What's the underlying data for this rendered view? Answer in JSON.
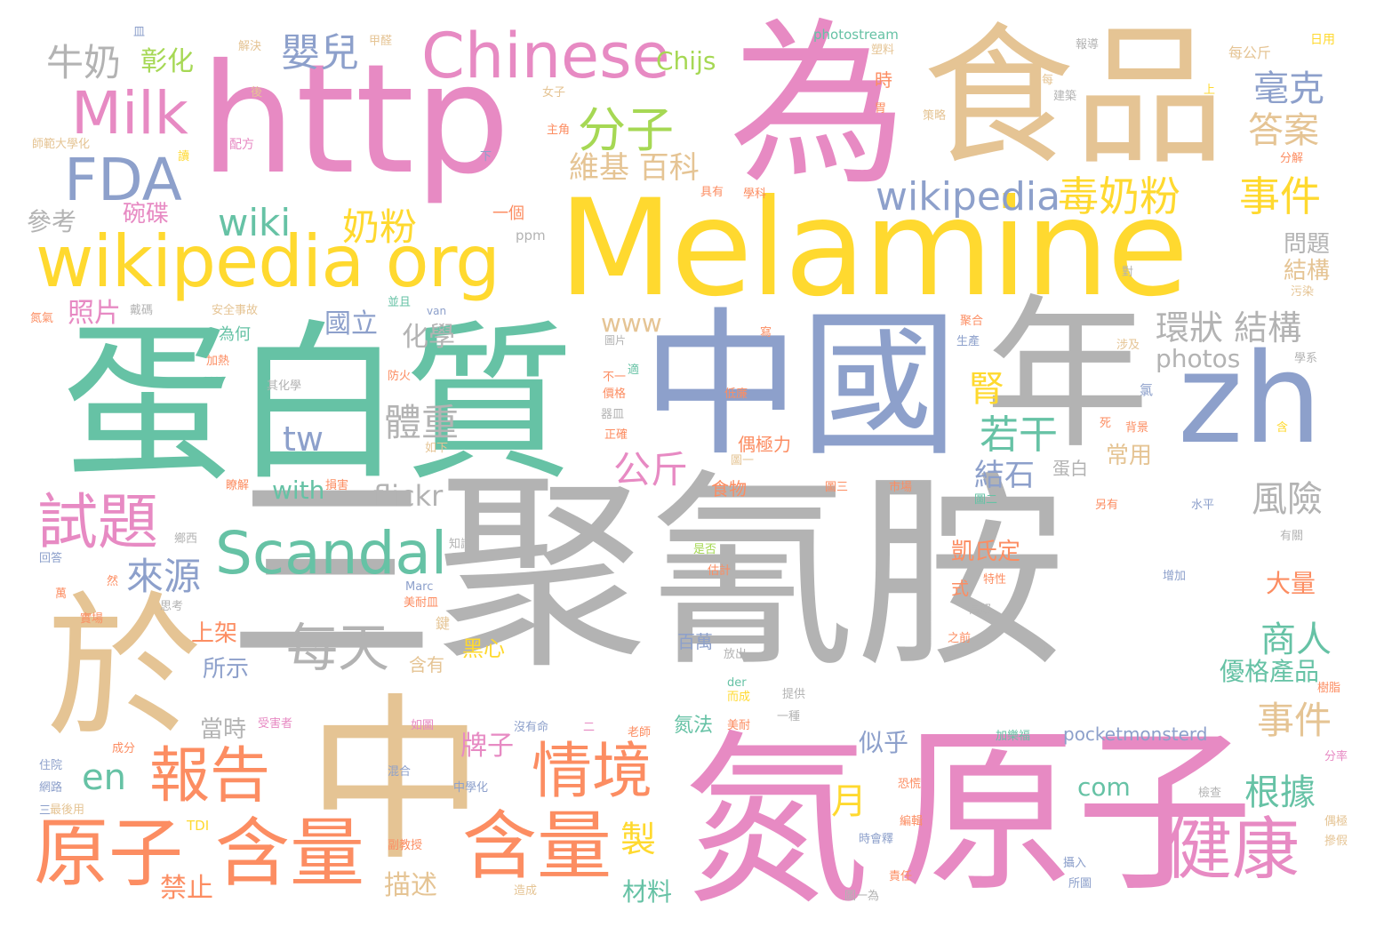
{
  "palette": {
    "pink": "#e78ac3",
    "yellow": "#ffd92f",
    "tan": "#e5c494",
    "gray": "#b3b3b3",
    "teal": "#66c2a5",
    "blue": "#8da0cb",
    "orange": "#fc8d62",
    "green": "#a6d854"
  },
  "words": [
    {
      "text": "三聚氰胺",
      "color": "gray"
    },
    {
      "text": "Melamine",
      "color": "yellow"
    },
    {
      "text": "中國",
      "color": "blue"
    },
    {
      "text": "蛋白質",
      "color": "teal"
    },
    {
      "text": "食品",
      "color": "tan"
    },
    {
      "text": "http",
      "color": "pink"
    },
    {
      "text": "為",
      "color": "pink"
    },
    {
      "text": "年",
      "color": "gray"
    },
    {
      "text": "氮",
      "color": "pink"
    },
    {
      "text": "原子",
      "color": "pink"
    },
    {
      "text": "中",
      "color": "tan"
    },
    {
      "text": "於",
      "color": "tan"
    },
    {
      "text": "zh",
      "color": "blue"
    },
    {
      "text": "wikipedia org",
      "color": "yellow"
    },
    {
      "text": "Chinese",
      "color": "pink"
    },
    {
      "text": "Milk",
      "color": "pink"
    },
    {
      "text": "FDA",
      "color": "blue"
    },
    {
      "text": "Scandal",
      "color": "teal"
    },
    {
      "text": "原子",
      "color": "orange"
    },
    {
      "text": "含量",
      "color": "orange"
    },
    {
      "text": "含量",
      "color": "orange"
    },
    {
      "text": "情境",
      "color": "orange"
    },
    {
      "text": "報告",
      "color": "orange"
    },
    {
      "text": "試題",
      "color": "pink"
    },
    {
      "text": "健康",
      "color": "pink"
    },
    {
      "text": "wikipedia",
      "color": "blue"
    },
    {
      "text": "毒奶粉",
      "color": "yellow"
    },
    {
      "text": "事件",
      "color": "yellow"
    },
    {
      "text": "分子",
      "color": "green"
    },
    {
      "text": "每天",
      "color": "gray"
    },
    {
      "text": "嬰兒",
      "color": "blue"
    },
    {
      "text": "牛奶",
      "color": "gray"
    },
    {
      "text": "彰化",
      "color": "green"
    },
    {
      "text": "wiki",
      "color": "teal"
    },
    {
      "text": "奶粉",
      "color": "yellow"
    },
    {
      "text": "維基 百科",
      "color": "tan"
    },
    {
      "text": "毫克",
      "color": "blue"
    },
    {
      "text": "答案",
      "color": "tan"
    },
    {
      "text": "Chijs",
      "color": "green"
    },
    {
      "text": "tw",
      "color": "blue"
    },
    {
      "text": "來源",
      "color": "blue"
    },
    {
      "text": "en",
      "color": "teal"
    },
    {
      "text": "照片",
      "color": "pink"
    },
    {
      "text": "碗碟",
      "color": "pink"
    },
    {
      "text": "參考",
      "color": "gray"
    },
    {
      "text": "國立",
      "color": "blue"
    },
    {
      "text": "化學",
      "color": "gray"
    },
    {
      "text": "環狀 結構",
      "color": "gray"
    },
    {
      "text": "體重",
      "color": "gray"
    },
    {
      "text": "腎",
      "color": "yellow"
    },
    {
      "text": "若干",
      "color": "teal"
    },
    {
      "text": "結石",
      "color": "blue"
    },
    {
      "text": "photos",
      "color": "gray"
    },
    {
      "text": "風險",
      "color": "gray"
    },
    {
      "text": "公斤",
      "color": "pink"
    },
    {
      "text": "with",
      "color": "teal"
    },
    {
      "text": "flickr",
      "color": "gray"
    },
    {
      "text": "商人",
      "color": "teal"
    },
    {
      "text": "優格產品",
      "color": "teal"
    },
    {
      "text": "事件",
      "color": "tan"
    },
    {
      "text": "根據",
      "color": "teal"
    },
    {
      "text": "月",
      "color": "yellow"
    },
    {
      "text": "製",
      "color": "yellow"
    },
    {
      "text": "com",
      "color": "teal"
    },
    {
      "text": "似乎",
      "color": "blue"
    },
    {
      "text": "牌子",
      "color": "pink"
    },
    {
      "text": "凱氏定",
      "color": "orange"
    },
    {
      "text": "大量",
      "color": "orange"
    },
    {
      "text": "上架",
      "color": "orange"
    },
    {
      "text": "所示",
      "color": "blue"
    },
    {
      "text": "當時",
      "color": "gray"
    },
    {
      "text": "禁止",
      "color": "orange"
    },
    {
      "text": "描述",
      "color": "tan"
    },
    {
      "text": "材料",
      "color": "teal"
    },
    {
      "text": "www",
      "color": "tan"
    },
    {
      "text": "問題",
      "color": "gray"
    },
    {
      "text": "結構",
      "color": "tan"
    },
    {
      "text": "常用",
      "color": "tan"
    },
    {
      "text": "pocketmonsterd",
      "color": "blue"
    },
    {
      "text": "為何",
      "color": "teal"
    },
    {
      "text": "一個",
      "color": "orange"
    },
    {
      "text": "黑心",
      "color": "yellow"
    },
    {
      "text": "含有",
      "color": "tan"
    },
    {
      "text": "百萬",
      "color": "blue"
    },
    {
      "text": "氮法",
      "color": "teal"
    },
    {
      "text": "食物",
      "color": "orange"
    },
    {
      "text": "偶極力",
      "color": "orange"
    },
    {
      "text": "photostream",
      "color": "teal"
    },
    {
      "text": "ppm",
      "color": "gray"
    },
    {
      "text": "van",
      "color": "blue"
    },
    {
      "text": "TDI",
      "color": "yellow"
    },
    {
      "text": "der",
      "color": "teal"
    },
    {
      "text": "Marc",
      "color": "blue"
    },
    {
      "text": "in",
      "color": "gray"
    },
    {
      "text": "解決",
      "color": "tan"
    },
    {
      "text": "甲醛",
      "color": "tan"
    },
    {
      "text": "報導",
      "color": "gray"
    },
    {
      "text": "每公斤",
      "color": "tan"
    },
    {
      "text": "日用",
      "color": "yellow"
    },
    {
      "text": "塑料",
      "color": "tan"
    },
    {
      "text": "時",
      "color": "orange"
    },
    {
      "text": "建築",
      "color": "gray"
    },
    {
      "text": "策略",
      "color": "tan"
    },
    {
      "text": "主角",
      "color": "orange"
    },
    {
      "text": "女子",
      "color": "tan"
    },
    {
      "text": "師範大學化",
      "color": "tan"
    },
    {
      "text": "配方",
      "color": "pink"
    },
    {
      "text": "分解",
      "color": "orange"
    },
    {
      "text": "學科",
      "color": "orange"
    },
    {
      "text": "具有",
      "color": "orange"
    },
    {
      "text": "污染",
      "color": "tan"
    },
    {
      "text": "安全事故",
      "color": "tan"
    },
    {
      "text": "戴碼",
      "color": "gray"
    },
    {
      "text": "氮氣",
      "color": "orange"
    },
    {
      "text": "加熱",
      "color": "orange"
    },
    {
      "text": "其化學",
      "color": "gray"
    },
    {
      "text": "防火",
      "color": "orange"
    },
    {
      "text": "正確",
      "color": "orange"
    },
    {
      "text": "價格",
      "color": "orange"
    },
    {
      "text": "低廉",
      "color": "orange"
    },
    {
      "text": "器皿",
      "color": "gray"
    },
    {
      "text": "涉及",
      "color": "tan"
    },
    {
      "text": "聚合",
      "color": "orange"
    },
    {
      "text": "生產",
      "color": "blue"
    },
    {
      "text": "圖片",
      "color": "gray"
    },
    {
      "text": "背景",
      "color": "orange"
    },
    {
      "text": "學系",
      "color": "gray"
    },
    {
      "text": "死",
      "color": "orange"
    },
    {
      "text": "蛋白",
      "color": "gray"
    },
    {
      "text": "圖一",
      "color": "tan"
    },
    {
      "text": "圖三",
      "color": "orange"
    },
    {
      "text": "圖二",
      "color": "teal"
    },
    {
      "text": "市場",
      "color": "orange"
    },
    {
      "text": "另有",
      "color": "orange"
    },
    {
      "text": "水平",
      "color": "blue"
    },
    {
      "text": "有關",
      "color": "gray"
    },
    {
      "text": "增加",
      "color": "blue"
    },
    {
      "text": "高級",
      "color": "gray"
    },
    {
      "text": "之前",
      "color": "orange"
    },
    {
      "text": "樹脂",
      "color": "orange"
    },
    {
      "text": "分率",
      "color": "pink"
    },
    {
      "text": "偶極",
      "color": "tan"
    },
    {
      "text": "摻假",
      "color": "tan"
    },
    {
      "text": "檢查",
      "color": "gray"
    },
    {
      "text": "攝入",
      "color": "blue"
    },
    {
      "text": "所圖",
      "color": "blue"
    },
    {
      "text": "責任",
      "color": "orange"
    },
    {
      "text": "時會釋",
      "color": "blue"
    },
    {
      "text": "恐慌",
      "color": "orange"
    },
    {
      "text": "編輯",
      "color": "orange"
    },
    {
      "text": "圖一為",
      "color": "gray"
    },
    {
      "text": "副教授",
      "color": "orange"
    },
    {
      "text": "中學化",
      "color": "blue"
    },
    {
      "text": "造成",
      "color": "tan"
    },
    {
      "text": "混合",
      "color": "blue"
    },
    {
      "text": "住院",
      "color": "blue"
    },
    {
      "text": "網路",
      "color": "blue"
    },
    {
      "text": "最後用",
      "color": "tan"
    },
    {
      "text": "成分",
      "color": "orange"
    },
    {
      "text": "受害者",
      "color": "pink"
    },
    {
      "text": "沒有命",
      "color": "blue"
    },
    {
      "text": "加樂福",
      "color": "teal"
    },
    {
      "text": "美耐皿",
      "color": "orange"
    },
    {
      "text": "實場",
      "color": "orange"
    },
    {
      "text": "知識",
      "color": "gray"
    },
    {
      "text": "思考",
      "color": "gray"
    },
    {
      "text": "損害",
      "color": "orange"
    },
    {
      "text": "瞭解",
      "color": "orange"
    },
    {
      "text": "估計",
      "color": "orange"
    },
    {
      "text": "是否",
      "color": "green"
    },
    {
      "text": "特性",
      "color": "orange"
    },
    {
      "text": "放出",
      "color": "gray"
    },
    {
      "text": "提供",
      "color": "gray"
    },
    {
      "text": "美耐",
      "color": "orange"
    },
    {
      "text": "而成",
      "color": "yellow"
    },
    {
      "text": "老師",
      "color": "orange"
    },
    {
      "text": "如圖",
      "color": "pink"
    },
    {
      "text": "如下",
      "color": "tan"
    },
    {
      "text": "鍵",
      "color": "tan"
    },
    {
      "text": "式",
      "color": "orange"
    },
    {
      "text": "一種",
      "color": "gray"
    },
    {
      "text": "不一",
      "color": "orange"
    },
    {
      "text": "鄉西",
      "color": "gray"
    },
    {
      "text": "回答",
      "color": "blue"
    },
    {
      "text": "寫",
      "color": "orange"
    },
    {
      "text": "氯",
      "color": "blue"
    },
    {
      "text": "上",
      "color": "yellow"
    },
    {
      "text": "下",
      "color": "blue"
    },
    {
      "text": "後",
      "color": "tan"
    },
    {
      "text": "讀",
      "color": "yellow"
    },
    {
      "text": "對",
      "color": "gray"
    },
    {
      "text": "並且",
      "color": "teal"
    },
    {
      "text": "適",
      "color": "teal"
    },
    {
      "text": "含",
      "color": "yellow"
    },
    {
      "text": "然",
      "color": "orange"
    },
    {
      "text": "萬",
      "color": "orange"
    },
    {
      "text": "二",
      "color": "pink"
    },
    {
      "text": "三",
      "color": "blue"
    },
    {
      "text": "皿",
      "color": "blue"
    },
    {
      "text": "胃",
      "color": "orange"
    },
    {
      "text": "每",
      "color": "tan"
    }
  ]
}
